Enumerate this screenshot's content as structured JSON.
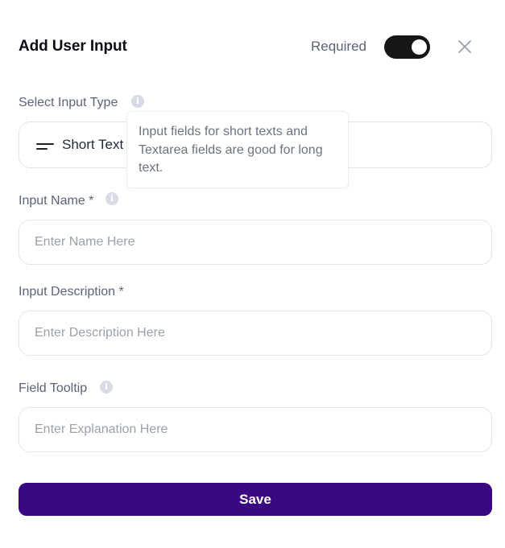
{
  "header": {
    "title": "Add User Input",
    "required_label": "Required",
    "required_on": true
  },
  "input_type": {
    "label": "Select Input Type",
    "value": "Short Text",
    "tooltip": "Input fields for short texts and Textarea fields are good for long text."
  },
  "input_name": {
    "label": "Input Name *",
    "placeholder": "Enter Name Here",
    "value": ""
  },
  "input_description": {
    "label": "Input Description *",
    "placeholder": "Enter Description Here",
    "value": ""
  },
  "field_tooltip": {
    "label": "Field Tooltip",
    "placeholder": "Enter Explanation Here",
    "value": ""
  },
  "actions": {
    "save_label": "Save"
  },
  "colors": {
    "primary": "#3a0783",
    "toggle_on": "#161616",
    "label": "#5b6478",
    "border": "#e3e5ea"
  },
  "icons": {
    "close": "close-icon",
    "info": "info-icon",
    "short_text": "short-text-icon"
  }
}
